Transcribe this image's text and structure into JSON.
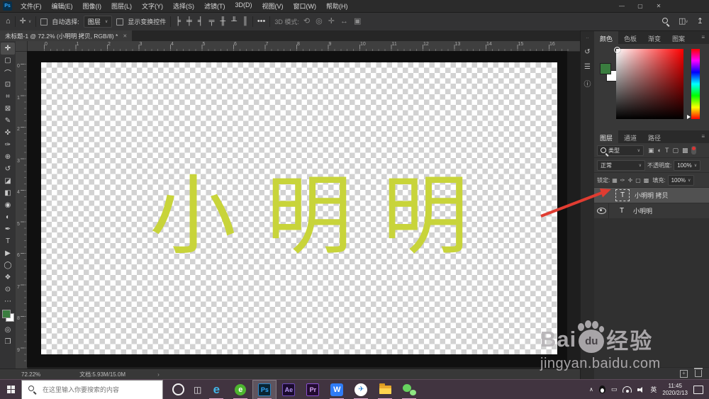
{
  "app": {
    "logo_text": "Ps",
    "window_controls": {
      "minimize": "—",
      "restore": "▢",
      "close": "✕"
    }
  },
  "menu_bar": {
    "items": [
      "文件(F)",
      "编辑(E)",
      "图像(I)",
      "图层(L)",
      "文字(Y)",
      "选择(S)",
      "滤镜(T)",
      "3D(D)",
      "视图(V)",
      "窗口(W)",
      "帮助(H)"
    ]
  },
  "options_bar": {
    "home_icon": "⌂",
    "move_icon": "✛",
    "auto_select_label": "自动选择:",
    "auto_select_value": "图层",
    "show_transform_label": "显示变换控件",
    "align_icons": [
      {
        "name": "align-left-icon",
        "glyph": "╞"
      },
      {
        "name": "align-center-h-icon",
        "glyph": "╪"
      },
      {
        "name": "align-right-icon",
        "glyph": "╡"
      },
      {
        "name": "align-top-icon",
        "glyph": "╤"
      },
      {
        "name": "distribute-h-icon",
        "glyph": "╫"
      },
      {
        "name": "distribute-v-icon",
        "glyph": "╨"
      },
      {
        "name": "distribute-spacing-icon",
        "glyph": "║"
      }
    ],
    "more_label": "•••",
    "mode_3d_label": "3D 模式:",
    "mode_3d_icons": [
      {
        "name": "3d-orbit-icon",
        "glyph": "⟲"
      },
      {
        "name": "3d-roll-icon",
        "glyph": "◎"
      },
      {
        "name": "3d-pan-icon",
        "glyph": "✛"
      },
      {
        "name": "3d-slide-icon",
        "glyph": "↔"
      },
      {
        "name": "3d-camera-icon",
        "glyph": "▣"
      }
    ],
    "share_icon": "↥"
  },
  "document_tab": {
    "title": "未标题-1 @ 72.2% (小明明 拷贝, RGB/8) *",
    "close": "✕"
  },
  "toolbar": {
    "tools": [
      {
        "name": "move-tool",
        "glyph": "✛",
        "active": true
      },
      {
        "name": "marquee-tool",
        "glyph": "▢"
      },
      {
        "name": "lasso-tool",
        "glyph": "⌒"
      },
      {
        "name": "object-selection-tool",
        "glyph": "⊡"
      },
      {
        "name": "crop-tool",
        "glyph": "⌗"
      },
      {
        "name": "frame-tool",
        "glyph": "⊠"
      },
      {
        "name": "eyedropper-tool",
        "glyph": "✎"
      },
      {
        "name": "healing-brush-tool",
        "glyph": "✜"
      },
      {
        "name": "brush-tool",
        "glyph": "✑"
      },
      {
        "name": "clone-stamp-tool",
        "glyph": "⊕"
      },
      {
        "name": "history-brush-tool",
        "glyph": "↺"
      },
      {
        "name": "eraser-tool",
        "glyph": "◪"
      },
      {
        "name": "gradient-tool",
        "glyph": "◧"
      },
      {
        "name": "blur-tool",
        "glyph": "◉"
      },
      {
        "name": "dodge-tool",
        "glyph": "◐"
      },
      {
        "name": "pen-tool",
        "glyph": "✒"
      },
      {
        "name": "type-tool",
        "glyph": "T"
      },
      {
        "name": "path-selection-tool",
        "glyph": "▶"
      },
      {
        "name": "shape-tool",
        "glyph": "◯"
      },
      {
        "name": "hand-tool",
        "glyph": "❖"
      },
      {
        "name": "zoom-tool",
        "glyph": "⊙"
      },
      {
        "name": "edit-toolbar-icon",
        "glyph": "⋯"
      }
    ],
    "foreground_color": "#3a7d3f",
    "background_color": "#ffffff",
    "quick_mask_icon": "◎",
    "screen_mode_icon": "❐"
  },
  "rulers": {
    "horizontal": [
      "0",
      "1",
      "2",
      "3",
      "4",
      "5",
      "6",
      "7",
      "8",
      "9",
      "10",
      "11",
      "12",
      "13",
      "14",
      "15",
      "16"
    ],
    "vertical": [
      "0",
      "1",
      "2",
      "3",
      "4",
      "5",
      "6",
      "7",
      "8",
      "9"
    ]
  },
  "canvas": {
    "text": "小明明",
    "text_color": "#c8d43a"
  },
  "dock_strip": {
    "icons": [
      {
        "name": "history-panel-icon",
        "glyph": "↺"
      },
      {
        "name": "properties-panel-icon",
        "glyph": "☰"
      },
      {
        "name": "info-panel-icon",
        "glyph": "ⓘ"
      }
    ]
  },
  "color_panel": {
    "tabs": [
      {
        "label": "颜色",
        "active": true
      },
      {
        "label": "色板"
      },
      {
        "label": "渐变"
      },
      {
        "label": "图案"
      }
    ],
    "menu_icon": "≡",
    "foreground_color": "#3a7d3f",
    "background_color": "#ffffff"
  },
  "layers_panel": {
    "tabs": [
      {
        "label": "图层",
        "active": true
      },
      {
        "label": "通道"
      },
      {
        "label": "路径"
      }
    ],
    "menu_icon": "≡",
    "filter_label": "类型",
    "filter_icons": [
      {
        "name": "filter-pixel-icon",
        "glyph": "▣"
      },
      {
        "name": "filter-adjustment-icon",
        "glyph": "◐"
      },
      {
        "name": "filter-type-icon",
        "glyph": "T"
      },
      {
        "name": "filter-shape-icon",
        "glyph": "▢"
      },
      {
        "name": "filter-smart-icon",
        "glyph": "▩"
      }
    ],
    "blend_mode": "正常",
    "opacity_label": "不透明度:",
    "opacity_value": "100%",
    "lock_label": "锁定:",
    "lock_icons": [
      {
        "name": "lock-transparent-icon",
        "glyph": "▦"
      },
      {
        "name": "lock-pixels-icon",
        "glyph": "✑"
      },
      {
        "name": "lock-position-icon",
        "glyph": "✛"
      },
      {
        "name": "lock-artboard-icon",
        "glyph": "▢"
      },
      {
        "name": "lock-all-icon",
        "glyph": "▩"
      }
    ],
    "fill_label": "填充:",
    "fill_value": "100%",
    "layers": [
      {
        "name": "小明明 拷贝",
        "type_badge": "T",
        "selected": true,
        "visible": false
      },
      {
        "name": "小明明",
        "type_badge": "T",
        "selected": false,
        "visible": true
      }
    ],
    "bottom_icons": [
      "new-layer-icon",
      "delete-layer-icon"
    ]
  },
  "status_bar": {
    "zoom_level": "72.22%",
    "doc_label": "文档:5.93M/15.0M",
    "chevron": "›"
  },
  "annotation": {
    "arrow_color": "#e03c31"
  },
  "watermark": {
    "text_bai": "Bai",
    "text_du": "du",
    "text_suffix": "经验",
    "url": "jingyan.baidu.com"
  },
  "taskbar": {
    "search_placeholder": "在这里输入你要搜索的内容",
    "task_view_icon": "◫",
    "apps": [
      {
        "name": "taskbar-edge",
        "glyph": "e",
        "cls": "app-edge",
        "running": true
      },
      {
        "name": "taskbar-360-browser",
        "glyph": "e",
        "cls": "app-360",
        "running": true
      },
      {
        "name": "taskbar-photoshop",
        "glyph": "Ps",
        "cls": "app-ps",
        "running": true,
        "active": true
      },
      {
        "name": "taskbar-after-effects",
        "glyph": "Ae",
        "cls": "app-ae",
        "running": false
      },
      {
        "name": "taskbar-premiere",
        "glyph": "Pr",
        "cls": "app-pr",
        "running": false
      },
      {
        "name": "taskbar-wps",
        "glyph": "W",
        "cls": "app-wps",
        "running": true
      },
      {
        "name": "taskbar-tim",
        "glyph": "✈",
        "cls": "app-tim",
        "running": true
      },
      {
        "name": "taskbar-explorer",
        "glyph": "",
        "cls": "app-folder",
        "running": true
      },
      {
        "name": "taskbar-wechat",
        "glyph": "",
        "cls": "app-wechat",
        "running": true
      }
    ],
    "tray": {
      "lang": "英",
      "time": "11:45",
      "date": "2020/2/13"
    }
  }
}
